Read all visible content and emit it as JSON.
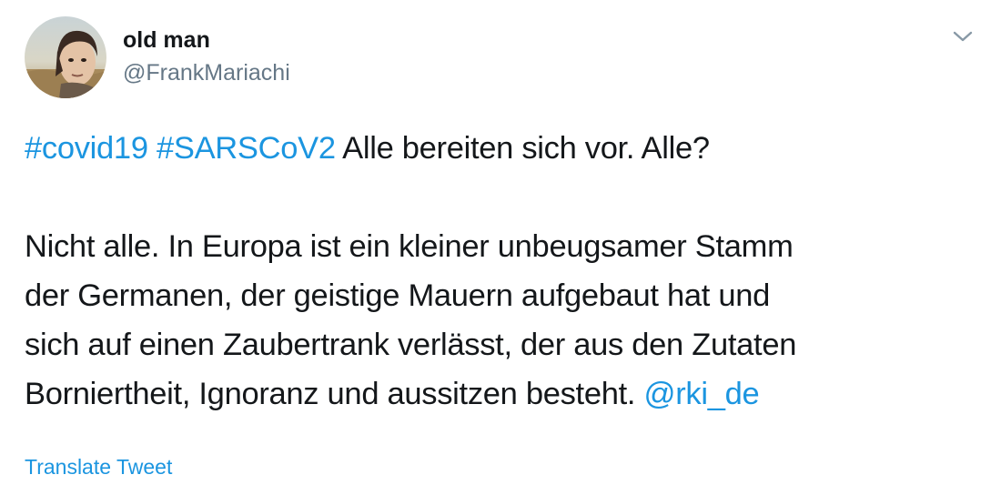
{
  "author": {
    "display_name": "old man",
    "handle": "@FrankMariachi",
    "avatar_icon": "user-avatar"
  },
  "menu": {
    "caret_icon": "chevron-down-icon"
  },
  "tweet": {
    "line1": {
      "hashtag1": "#covid19",
      "hashtag2": "#SARSCoV2",
      "text": "Alle bereiten sich vor. Alle?"
    },
    "line2": "Nicht alle. In Europa ist ein kleiner unbeugsamer Stamm",
    "line3": "der Germanen, der geistige Mauern aufgebaut hat und",
    "line4": "sich auf einen Zaubertrank verlässt, der aus den Zutaten",
    "line5": {
      "text": "Borniertheit, Ignoranz und aussitzen besteht.",
      "mention": "@rki_de"
    }
  },
  "translate_label": "Translate Tweet",
  "colors": {
    "link": "#1b95e0",
    "text": "#14171a",
    "secondary": "#657786"
  }
}
